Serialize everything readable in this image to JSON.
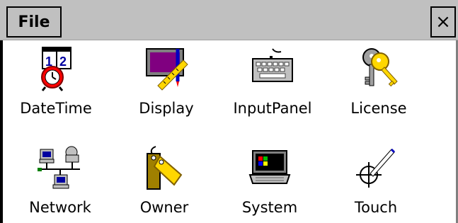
{
  "menubar": {
    "file_label": "File",
    "close_symbol": "×"
  },
  "items": [
    {
      "label": "DateTime",
      "icon": "datetime-icon"
    },
    {
      "label": "Display",
      "icon": "display-icon"
    },
    {
      "label": "InputPanel",
      "icon": "keyboard-icon"
    },
    {
      "label": "License",
      "icon": "keys-icon"
    },
    {
      "label": "Network",
      "icon": "network-icon"
    },
    {
      "label": "Owner",
      "icon": "tag-icon"
    },
    {
      "label": "System",
      "icon": "system-icon"
    },
    {
      "label": "Touch",
      "icon": "touch-crosshair-icon"
    }
  ],
  "colors": {
    "chrome": "#c0c0c0",
    "accent_blue": "#0000a0",
    "accent_yellow": "#ffff00",
    "accent_red": "#ff0000"
  }
}
